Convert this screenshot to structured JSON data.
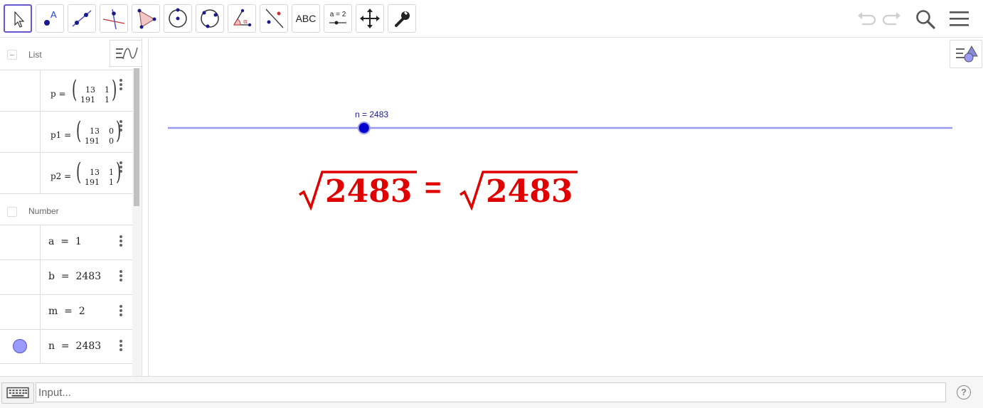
{
  "toolbar": {
    "tools": [
      {
        "name": "move-tool",
        "icon": "arrow-cursor-icon",
        "active": true
      },
      {
        "name": "point-tool",
        "icon": "point-icon",
        "label": "A"
      },
      {
        "name": "line-tool",
        "icon": "line-icon"
      },
      {
        "name": "perpendicular-line-tool",
        "icon": "perpendicular-line-icon"
      },
      {
        "name": "polygon-tool",
        "icon": "polygon-icon"
      },
      {
        "name": "circle-center-point-tool",
        "icon": "circle-center-icon"
      },
      {
        "name": "circle-three-points-tool",
        "icon": "circle-three-points-icon"
      },
      {
        "name": "angle-tool",
        "icon": "angle-icon",
        "label": "α"
      },
      {
        "name": "reflect-tool",
        "icon": "reflect-line-icon"
      },
      {
        "name": "text-tool",
        "icon": "text-icon",
        "label": "ABC"
      },
      {
        "name": "slider-tool",
        "icon": "slider-icon",
        "label": "a = 2"
      },
      {
        "name": "move-graphics-view-tool",
        "icon": "move-arrows-icon"
      },
      {
        "name": "settings-tool",
        "icon": "wrench-icon"
      }
    ],
    "right_icons": [
      "undo-icon",
      "redo-icon",
      "search-icon",
      "hamburger-menu-icon"
    ]
  },
  "algebra": {
    "groups": [
      {
        "title": "List",
        "rows": [
          {
            "name": "p",
            "matrix": [
              [
                "13",
                "1"
              ],
              [
                "191",
                "1"
              ]
            ]
          },
          {
            "name": "p1",
            "matrix": [
              [
                "13",
                "0"
              ],
              [
                "191",
                "0"
              ]
            ]
          },
          {
            "name": "p2",
            "matrix": [
              [
                "13",
                "1"
              ],
              [
                "191",
                "1"
              ]
            ]
          }
        ]
      },
      {
        "title": "Number",
        "rows": [
          {
            "expr": "a  =  1"
          },
          {
            "expr": "b  =  2483"
          },
          {
            "expr": "m  =  2"
          },
          {
            "expr": "n  =  2483",
            "visible_marble": true
          }
        ]
      }
    ],
    "equals": "="
  },
  "graphics": {
    "slider": {
      "label": "n = 2483",
      "value": 2483,
      "position_fraction": 0.25
    },
    "formula": {
      "left": "2483",
      "equals": "=",
      "right": "2483",
      "color": "#e00000"
    }
  },
  "input": {
    "placeholder": "Input..."
  },
  "colors": {
    "accent": "#6557d2",
    "slider": "#9999ff",
    "slider_point": "#0000cc",
    "formula": "#e00000"
  }
}
